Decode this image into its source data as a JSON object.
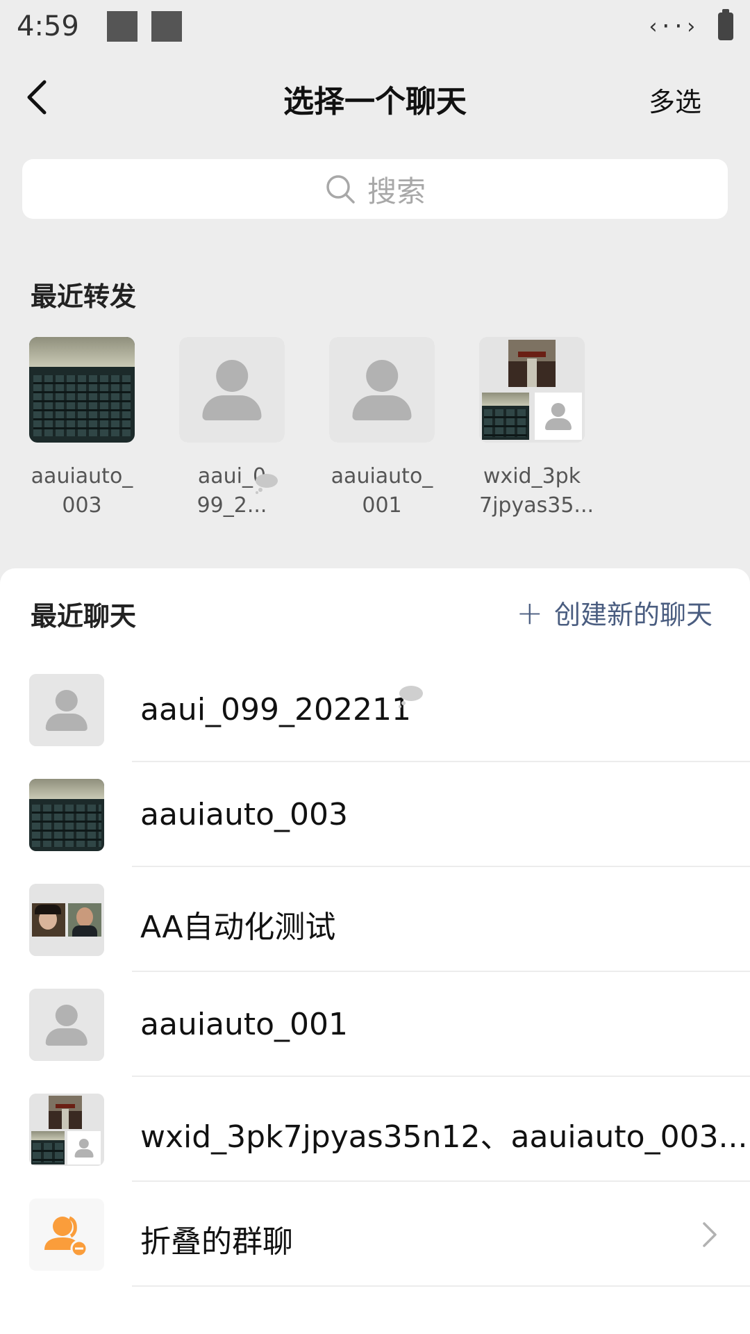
{
  "status_bar": {
    "time": "4:59",
    "network": "‹··›"
  },
  "header": {
    "title": "选择一个聊天",
    "multi_select": "多选"
  },
  "search": {
    "placeholder": "搜索"
  },
  "recent_forward": {
    "title": "最近转发",
    "items": [
      {
        "name_line1": "aauiauto_",
        "name_line2": "003",
        "avatar": "keyboard-photo"
      },
      {
        "name_line1": "aaui_0",
        "name_line2": "99_2...",
        "avatar": "default-person",
        "muted_icon": true
      },
      {
        "name_line1": "aauiauto_",
        "name_line2": "001",
        "avatar": "default-person"
      },
      {
        "name_line1": "wxid_3pk",
        "name_line2": "7jpyas35...",
        "avatar": "group-composite"
      }
    ]
  },
  "recent_chats": {
    "title": "最近聊天",
    "create_label": "创建新的聊天",
    "items": [
      {
        "name": "aaui_099_202211",
        "avatar": "default-person",
        "muted_icon": true
      },
      {
        "name": "aauiauto_003",
        "avatar": "keyboard-photo"
      },
      {
        "name": "AA自动化测试",
        "avatar": "group-two-photos"
      },
      {
        "name": "aauiauto_001",
        "avatar": "default-person"
      },
      {
        "name": "wxid_3pk7jpyas35n12、aauiauto_003...",
        "avatar": "group-composite"
      },
      {
        "name": "折叠的群聊",
        "avatar": "folded-group-icon",
        "chevron": true
      }
    ]
  },
  "colors": {
    "accent_link": "#4a5d80",
    "fold_icon": "#fa9d3b",
    "background": "#ededed"
  }
}
